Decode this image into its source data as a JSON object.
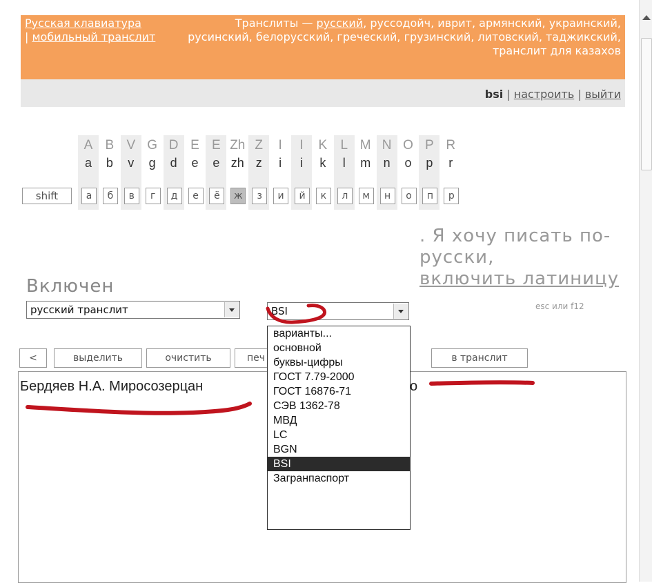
{
  "header": {
    "left_links": [
      "Русская клавиатура",
      "мобильный транслит"
    ],
    "left_separator": " | ",
    "right_prefix": "Транслиты — ",
    "right_link": "русский",
    "right_rest": ", руссодойч, иврит, армянский, украинский, русинский, белорусский, греческий, грузинский, литовский, таджикский, транслит для казахов"
  },
  "userbar": {
    "user": "bsi",
    "sep": " | ",
    "settings": "настроить",
    "logout": "выйти"
  },
  "keyboard": {
    "shift_label": "shift",
    "keys": [
      {
        "up": "A",
        "lo": "a",
        "cyr": "а",
        "shade": true
      },
      {
        "up": "B",
        "lo": "b",
        "cyr": "б",
        "shade": false
      },
      {
        "up": "V",
        "lo": "v",
        "cyr": "в",
        "shade": true
      },
      {
        "up": "G",
        "lo": "g",
        "cyr": "г",
        "shade": false
      },
      {
        "up": "D",
        "lo": "d",
        "cyr": "д",
        "shade": true
      },
      {
        "up": "E",
        "lo": "e",
        "cyr": "е",
        "shade": false
      },
      {
        "up": "E",
        "lo": "e",
        "cyr": "ё",
        "shade": true
      },
      {
        "up": "Zh",
        "lo": "zh",
        "cyr": "ж",
        "shade": false,
        "active": true
      },
      {
        "up": "Z",
        "lo": "z",
        "cyr": "з",
        "shade": true
      },
      {
        "up": "I",
        "lo": "i",
        "cyr": "и",
        "shade": false
      },
      {
        "up": "I",
        "lo": "i",
        "cyr": "й",
        "shade": true
      },
      {
        "up": "K",
        "lo": "k",
        "cyr": "к",
        "shade": false
      },
      {
        "up": "L",
        "lo": "l",
        "cyr": "л",
        "shade": true
      },
      {
        "up": "M",
        "lo": "m",
        "cyr": "м",
        "shade": false
      },
      {
        "up": "N",
        "lo": "n",
        "cyr": "н",
        "shade": true
      },
      {
        "up": "O",
        "lo": "o",
        "cyr": "о",
        "shade": false
      },
      {
        "up": "P",
        "lo": "p",
        "cyr": "п",
        "shade": true
      },
      {
        "up": "R",
        "lo": "r",
        "cyr": "р",
        "shade": false
      }
    ]
  },
  "status": {
    "enabled_label": "Включен"
  },
  "message": {
    "prefix": ". Я хочу писать по-русски,",
    "link": "включить латиницу",
    "hint": "esc или f12"
  },
  "layout_select": {
    "value": "русский транслит"
  },
  "scheme_select": {
    "value": "BSI",
    "options": [
      "варианты...",
      "основной",
      "буквы-цифры",
      "ГОСТ 7.79-2000",
      "ГОСТ 16876-71",
      "СЭВ 1362-78",
      "МВД",
      "LC",
      "BGN",
      "BSI",
      "Загранпаспорт"
    ],
    "selected": "BSI"
  },
  "toolbar": {
    "back": "<",
    "select_all": "выделить",
    "clear": "очистить",
    "print_partial": "печ",
    "to_translit": "в транслит"
  },
  "editor": {
    "text_visible": "Бердяев Н.А. Миросозерцан",
    "text_after": "о"
  },
  "annotation_color": "#c0141e"
}
